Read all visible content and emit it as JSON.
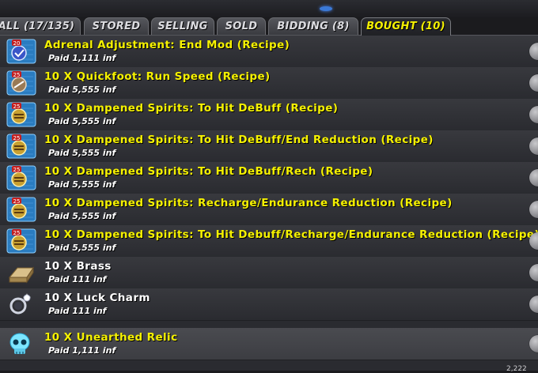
{
  "tabs": [
    {
      "label": "ALL (17/135)",
      "active": false
    },
    {
      "label": "STORED",
      "active": false
    },
    {
      "label": "SELLING",
      "active": false
    },
    {
      "label": "SOLD",
      "active": false
    },
    {
      "label": "BIDDING (8)",
      "active": false
    },
    {
      "label": "BOUGHT (10)",
      "active": true
    }
  ],
  "items": [
    {
      "name": "Adrenal Adjustment: End Mod (Recipe)",
      "paid": "Paid 1,111 inf",
      "icon": "recipe-icon",
      "level": "20"
    },
    {
      "name": "10 X Quickfoot: Run Speed (Recipe)",
      "paid": "Paid 5,555 inf",
      "icon": "recipe-icon",
      "level": "25"
    },
    {
      "name": "10 X Dampened Spirits: To Hit DeBuff (Recipe)",
      "paid": "Paid 5,555 inf",
      "icon": "recipe-icon",
      "level": "25"
    },
    {
      "name": "10 X Dampened Spirits: To Hit DeBuff/End Reduction (Recipe)",
      "paid": "Paid 5,555 inf",
      "icon": "recipe-icon",
      "level": "25"
    },
    {
      "name": "10 X Dampened Spirits: To Hit DeBuff/Rech (Recipe)",
      "paid": "Paid 5,555 inf",
      "icon": "recipe-icon",
      "level": "25"
    },
    {
      "name": "10 X Dampened Spirits: Recharge/Endurance Reduction (Recipe)",
      "paid": "Paid 5,555 inf",
      "icon": "recipe-icon",
      "level": "25"
    },
    {
      "name": "10 X Dampened Spirits: To Hit Debuff/Recharge/Endurance Reduction (Recipe)",
      "paid": "Paid 5,555 inf",
      "icon": "recipe-icon",
      "level": "25"
    },
    {
      "name": "10 X Brass",
      "paid": "Paid 111 inf",
      "icon": "brass-ingot-icon"
    },
    {
      "name": "10 X Luck Charm",
      "paid": "Paid 111 inf",
      "icon": "luck-charm-icon"
    },
    {
      "name": "10 X Unearthed Relic",
      "paid": "Paid 1,111 inf",
      "icon": "skull-relic-icon"
    }
  ],
  "colors": {
    "accent": "#f5f100",
    "recipe_bg": "#2a7cc0",
    "level_badge": "#c41e1e"
  },
  "footer": {
    "text": "2,222"
  }
}
